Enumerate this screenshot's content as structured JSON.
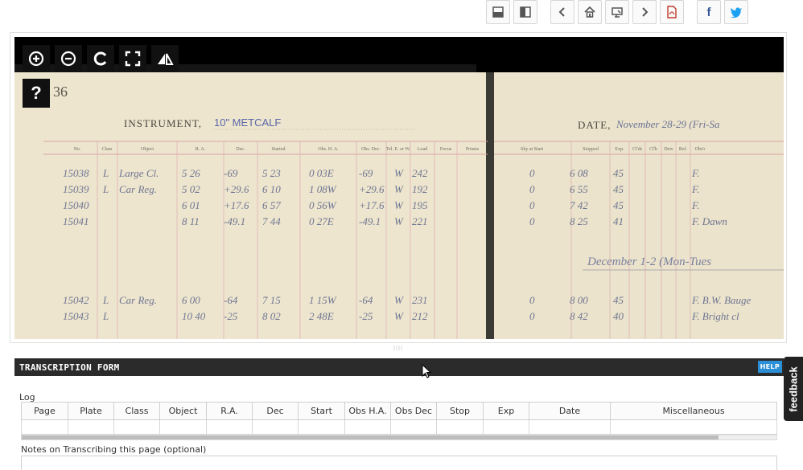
{
  "toolbar": {
    "buttons": [
      {
        "name": "layout-horizontal",
        "glyph": "▀"
      },
      {
        "name": "layout-vertical",
        "glyph": "◧"
      },
      {
        "name": "prev",
        "glyph": "‹"
      },
      {
        "name": "home",
        "glyph": "⌂"
      },
      {
        "name": "slideshow",
        "glyph": "⧉"
      },
      {
        "name": "next",
        "glyph": "›"
      },
      {
        "name": "pdf",
        "glyph": "⎘"
      },
      {
        "name": "facebook",
        "glyph": "f"
      },
      {
        "name": "twitter",
        "glyph": "✦"
      }
    ]
  },
  "viewer": {
    "controls": [
      {
        "name": "zoom-in",
        "glyph": "⊕"
      },
      {
        "name": "zoom-out",
        "glyph": "⊖"
      },
      {
        "name": "rotate",
        "glyph": "↻"
      },
      {
        "name": "fullscreen",
        "glyph": "⛶"
      },
      {
        "name": "flip",
        "glyph": "◭"
      }
    ],
    "help_label": "?",
    "ledger": {
      "page_no": "36",
      "instrument_label": "INSTRUMENT,",
      "instrument_value": "10\" METCALF",
      "date_label": "DATE,",
      "date_value": "November 28-29 (Fri-Sa",
      "columns_left": [
        "No.",
        "Class",
        "Object",
        "R. A.",
        "Dec.",
        "Started",
        "Obs. H. A.",
        "Obs. Dec.",
        "Tel. E. or W.",
        "Load",
        "Focus",
        "Prisms"
      ],
      "columns_right": [
        "Sky at Start",
        "Stopped",
        "Exp.",
        "Cl'ds",
        "Cl'k",
        "Dew",
        "Ref.",
        "Obs'r"
      ],
      "rows": [
        {
          "no": "15038",
          "cls": "L",
          "obj": "Large Cl.",
          "ra": "5 26",
          "dec": "-69",
          "start": "5 23",
          "oha": "0 03E",
          "odec": "-69",
          "tel": "W",
          "load": "242",
          "sky": "0",
          "stop": "6 08",
          "exp": "45",
          "obs": "F."
        },
        {
          "no": "15039",
          "cls": "L",
          "obj": "Car Reg.",
          "ra": "5 02",
          "dec": "+29.6",
          "start": "6 10",
          "oha": "1 08W",
          "odec": "+29.6",
          "tel": "W",
          "load": "192",
          "sky": "0",
          "stop": "6 55",
          "exp": "45",
          "obs": "F."
        },
        {
          "no": "15040",
          "cls": "",
          "obj": "",
          "ra": "6 01",
          "dec": "+17.6",
          "start": "6 57",
          "oha": "0 56W",
          "odec": "+17.6",
          "tel": "W",
          "load": "195",
          "sky": "0",
          "stop": "7 42",
          "exp": "45",
          "obs": "F."
        },
        {
          "no": "15041",
          "cls": "",
          "obj": "",
          "ra": "8 11",
          "dec": "-49.1",
          "start": "7 44",
          "oha": "0 27E",
          "odec": "-49.1",
          "tel": "W",
          "load": "221",
          "sky": "0",
          "stop": "8 25",
          "exp": "41",
          "obs": "F. Dawn"
        },
        {
          "no": "15042",
          "cls": "L",
          "obj": "Car Reg.",
          "ra": "6 00",
          "dec": "-64",
          "start": "7 15",
          "oha": "1 15W",
          "odec": "-64",
          "tel": "W",
          "load": "231",
          "sky": "0",
          "stop": "8 00",
          "exp": "45",
          "obs": "F. B.W. Bauge"
        },
        {
          "no": "15043",
          "cls": "L",
          "obj": "",
          "ra": "10 40",
          "dec": "-25",
          "start": "8 02",
          "oha": "2 48E",
          "odec": "-25",
          "tel": "W",
          "load": "212",
          "sky": "0",
          "stop": "8 42",
          "exp": "40",
          "obs": "F. Bright cl"
        }
      ],
      "section_note": "December 1-2 (Mon-Tues"
    }
  },
  "form": {
    "title": "TRANSCRIPTION FORM",
    "help": "HELP",
    "log_label": "Log",
    "columns": [
      "Page",
      "Plate",
      "Class",
      "Object",
      "R.A.",
      "Dec",
      "Start",
      "Obs H.A.",
      "Obs Dec",
      "Stop",
      "Exp",
      "Date",
      "Miscellaneous"
    ],
    "notes_label": "Notes on Transcribing this page (optional)"
  },
  "feedback_label": "feedback",
  "splitter_label": "||||"
}
